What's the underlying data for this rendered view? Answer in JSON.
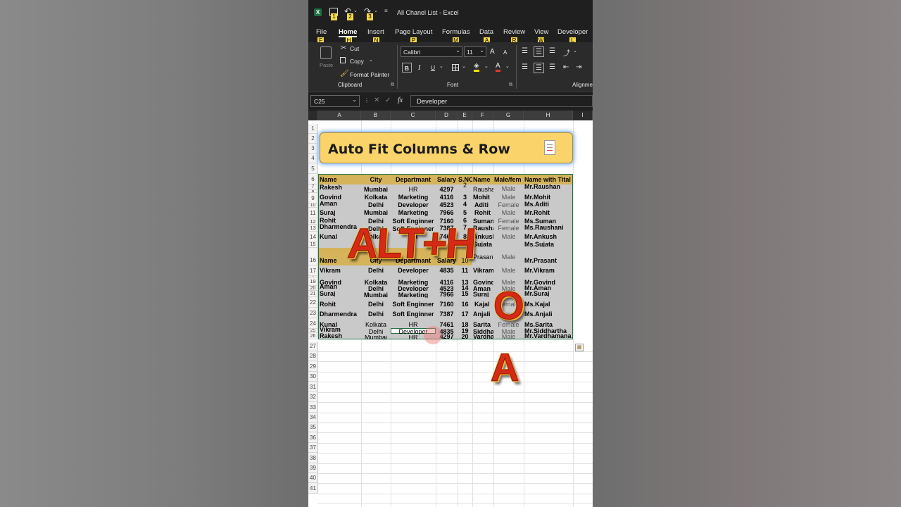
{
  "window": {
    "title": "All Chanel List - Excel"
  },
  "qat_keytips": [
    "1",
    "2",
    "3"
  ],
  "ribbon_tabs": [
    {
      "label": "File",
      "key": "F"
    },
    {
      "label": "Home",
      "key": "H"
    },
    {
      "label": "Insert",
      "key": "N"
    },
    {
      "label": "Page Layout",
      "key": "P"
    },
    {
      "label": "Formulas",
      "key": "M"
    },
    {
      "label": "Data",
      "key": "A"
    },
    {
      "label": "Review",
      "key": "R"
    },
    {
      "label": "View",
      "key": "W"
    },
    {
      "label": "Developer",
      "key": "L"
    }
  ],
  "clipboard": {
    "paste": "Paste",
    "cut": "Cut",
    "copy": "Copy",
    "format_painter": "Format Painter",
    "group": "Clipboard"
  },
  "font": {
    "name": "Calibri",
    "size": "11",
    "group": "Font",
    "bold": "B",
    "italic": "I",
    "underline": "U",
    "grow": "A",
    "shrink": "A",
    "color": "A"
  },
  "alignment": {
    "group": "Alignme"
  },
  "formula_bar": {
    "name_box": "C25",
    "value": "Developer",
    "fx": "fx"
  },
  "columns": [
    "A",
    "B",
    "C",
    "D",
    "E",
    "F",
    "G",
    "H",
    "I"
  ],
  "banner": {
    "title": "Auto Fit Columns & Row"
  },
  "overlay": {
    "line1": "ALT+H",
    "line2": "O",
    "line3": "A"
  },
  "headers": {
    "name": "Name",
    "city": "City",
    "dept": "Departmant",
    "salary": "Salary",
    "sno": "S.NO",
    "name2": "Name",
    "gender": "Male/fem",
    "titled": "Name with Tital"
  },
  "rows": [
    {
      "r": "7",
      "a": "",
      "b": "Delhi",
      "c": "Developer",
      "d": "4835",
      "e": "2",
      "f": "Vikram",
      "g": "Male",
      "h": "Mr.Vikram"
    },
    {
      "r": "8",
      "a": "Rakesh",
      "b": "Mumbai",
      "c": "HR",
      "d": "4297",
      "e": "2",
      "f": "Raushan",
      "g": "Male",
      "h": "Mr.Raushan"
    },
    {
      "r": "9",
      "a": "Govind",
      "b": "Kolkata",
      "c": "Marketing",
      "d": "4116",
      "e": "3",
      "f": "Mohit",
      "g": "Male",
      "h": "Mr.Mohit"
    },
    {
      "r": "10",
      "a": "Aman",
      "b": "Delhi",
      "c": "Developer",
      "d": "4523",
      "e": "4",
      "f": "Aditi",
      "g": "Female",
      "h": "Ms.Aditi"
    },
    {
      "r": "11",
      "a": "Suraj",
      "b": "Mumbai",
      "c": "Marketing",
      "d": "7966",
      "e": "5",
      "f": "Rohit",
      "g": "Male",
      "h": "Mr.Rohit"
    },
    {
      "r": "12",
      "a": "Rohit",
      "b": "Delhi",
      "c": "Soft Enginner",
      "d": "7160",
      "e": "6",
      "f": "Suman",
      "g": "Female",
      "h": "Ms.Suman"
    },
    {
      "r": "13",
      "a": "Dharmendra",
      "b": "Delhi",
      "c": "Soft Enginner",
      "d": "7387",
      "e": "7",
      "f": "Raushani",
      "g": "Female",
      "h": "Ms.Raushani"
    },
    {
      "r": "14",
      "a": "Kunal",
      "b": "Kolkata",
      "c": "HR",
      "d": "7461",
      "e": "8",
      "f": "Ankush",
      "g": "Male",
      "h": "Mr.Ankush"
    },
    {
      "r": "15",
      "a": "",
      "b": "",
      "c": "",
      "d": "",
      "e": "9",
      "f": "Sujata",
      "g": "",
      "h": "Ms.Sujata"
    },
    {
      "r": "17",
      "a": "Vikram",
      "b": "Delhi",
      "c": "Developer",
      "d": "4835",
      "e": "11",
      "f": "Vikram",
      "g": "Male",
      "h": "Mr.Vikram"
    },
    {
      "r": "19",
      "a": "Govind",
      "b": "Kolkata",
      "c": "Marketing",
      "d": "4116",
      "e": "13",
      "f": "Govind",
      "g": "Male",
      "h": "Mr.Govind"
    },
    {
      "r": "20",
      "a": "Aman",
      "b": "Delhi",
      "c": "Developer",
      "d": "4523",
      "e": "14",
      "f": "Aman",
      "g": "Male",
      "h": "Mr.Aman"
    },
    {
      "r": "21",
      "a": "Suraj",
      "b": "Mumbai",
      "c": "Marketing",
      "d": "7966",
      "e": "15",
      "f": "Suraj",
      "g": "Male",
      "h": "Mr.Suraj"
    },
    {
      "r": "22",
      "a": "Rohit",
      "b": "Delhi",
      "c": "Soft Enginner",
      "d": "7160",
      "e": "16",
      "f": "Kajal",
      "g": "Female",
      "h": "Ms.Kajal"
    },
    {
      "r": "23",
      "a": "Dharmendra",
      "b": "Delhi",
      "c": "Soft Enginner",
      "d": "7387",
      "e": "17",
      "f": "Anjali",
      "g": "Female",
      "h": "Ms.Anjali"
    },
    {
      "r": "24",
      "a": "Kunal",
      "b": "Kolkata",
      "c": "HR",
      "d": "7461",
      "e": "18",
      "f": "Sarita",
      "g": "Female",
      "h": "Ms.Sarita"
    },
    {
      "r": "25",
      "a": "Vikram",
      "b": "Delhi",
      "c": "Developer",
      "d": "4835",
      "e": "19",
      "f": "Siddharth",
      "g": "Male",
      "h": "Mr.Siddhartha"
    },
    {
      "r": "26",
      "a": "Rakesh",
      "b": "Mumbai",
      "c": "HR",
      "d": "4297",
      "e": "20",
      "f": "Vardhaman",
      "g": "Male",
      "h": "Mr.Vardhamana"
    }
  ],
  "row16": {
    "r": "16",
    "f": "Prasant",
    "g": "Male",
    "h": "Mr.Prasant",
    "e": "10"
  },
  "row_numbers": [
    "1",
    "2",
    "3",
    "4",
    "5",
    "6",
    "7",
    "8",
    "9",
    "10",
    "11",
    "12",
    "13",
    "14",
    "15",
    "16",
    "17",
    "18",
    "19",
    "20",
    "21",
    "22",
    "23",
    "24",
    "25",
    "26",
    "27",
    "28",
    "29",
    "30",
    "31",
    "32",
    "33",
    "34",
    "35",
    "36",
    "37",
    "38",
    "39",
    "40",
    "41"
  ],
  "colors": {
    "banner_fill": "#fad46a",
    "header_fill": "#d4b35a",
    "selection_overlay": "#c9c9c9",
    "accent": "#217346"
  }
}
